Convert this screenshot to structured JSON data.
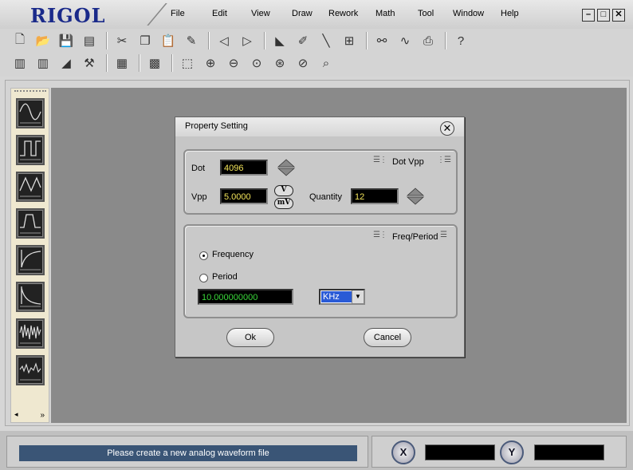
{
  "app": {
    "logo": "RIGOL",
    "menu": [
      "File",
      "Edit",
      "View",
      "Draw",
      "Rework",
      "Math",
      "Tool",
      "Window",
      "Help"
    ],
    "window_controls": [
      "minimize-icon",
      "maximize-icon",
      "close-icon"
    ]
  },
  "toolbar": {
    "row1": [
      "new-file-icon",
      "open-folder-icon",
      "save-icon",
      "save-all-icon",
      "|",
      "cut-icon",
      "copy-icon",
      "paste-icon",
      "eraser-icon",
      "|",
      "left-marker-icon",
      "right-marker-icon",
      "|",
      "cursor-icon",
      "pen-icon",
      "line-icon",
      "grid-math-icon",
      "|",
      "link-icon",
      "wave-download-icon",
      "device-icon",
      "|",
      "help-icon"
    ],
    "row2": [
      "bar-chart-icon",
      "bar-chart-2-icon",
      "area-chart-icon",
      "tool-icon",
      "|",
      "grid-icon",
      "|",
      "grid-select-icon",
      "|",
      "select-rect-icon",
      "zoom-in-icon",
      "zoom-out-icon",
      "zoom-icon",
      "zoom-fit-icon",
      "zoom-reset-icon",
      "zoom-search-icon"
    ]
  },
  "side_palette": [
    "sine-wave-icon",
    "square-wave-icon",
    "ramp-wave-icon",
    "pulse-wave-icon",
    "exp-rise-icon",
    "exp-fall-icon",
    "noise-wave-icon",
    "arb-wave-icon"
  ],
  "dialog": {
    "title": "Property Setting",
    "close_label": "x",
    "dot_vpp": {
      "title": "Dot Vpp",
      "dot_label": "Dot",
      "dot_value": "4096",
      "vpp_label": "Vpp",
      "vpp_value": "5.0000",
      "unit_v": "V",
      "unit_mv": "mV",
      "quantity_label": "Quantity",
      "quantity_value": "12"
    },
    "freq_period": {
      "title": "Freq/Period",
      "frequency_label": "Frequency",
      "period_label": "Period",
      "selected": "Frequency",
      "value": "10.000000000",
      "unit_selected": "KHz"
    },
    "ok_label": "Ok",
    "cancel_label": "Cancel"
  },
  "status": {
    "message": "Please create a new analog waveform file",
    "x_label": "X",
    "y_label": "Y",
    "x_value": "",
    "y_value": ""
  }
}
